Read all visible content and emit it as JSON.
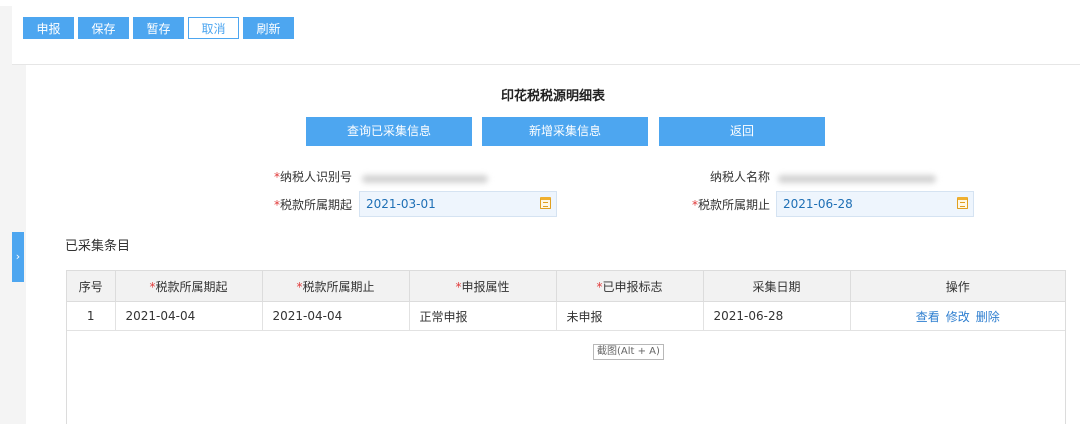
{
  "toolbar": {
    "declare_label": "申报",
    "save_label": "保存",
    "temp_save_label": "暂存",
    "cancel_label": "取消",
    "refresh_label": "刷新"
  },
  "page": {
    "title": "印花税税源明细表"
  },
  "actions": {
    "query_collected_label": "查询已采集信息",
    "add_collect_label": "新增采集信息",
    "back_label": "返回"
  },
  "form": {
    "taxpayer_id_label": "纳税人识别号",
    "taxpayer_name_label": "纳税人名称",
    "period_start_label": "税款所属期起",
    "period_start_value": "2021-03-01",
    "period_end_label": "税款所属期止",
    "period_end_value": "2021-06-28",
    "required_mark": "*"
  },
  "section": {
    "collected_title": "已采集条目"
  },
  "table": {
    "headers": {
      "index": "序号",
      "period_start": "税款所属期起",
      "period_end": "税款所属期止",
      "declare_attr": "申报属性",
      "declared_flag": "已申报标志",
      "collect_date": "采集日期",
      "operation": "操作"
    },
    "rows": [
      {
        "index": "1",
        "period_start": "2021-04-04",
        "period_end": "2021-04-04",
        "declare_attr": "正常申报",
        "declared_flag": "未申报",
        "collect_date": "2021-06-28",
        "ops": {
          "view": "查看",
          "edit": "修改",
          "delete": "删除"
        }
      }
    ]
  },
  "tooltip": {
    "text": "截图(Alt + A)"
  },
  "icons": {
    "calendar": "calendar-icon",
    "expand": "chevron-right-icon"
  },
  "colors": {
    "primary": "#4da6f0",
    "required": "#e03a3a",
    "link": "#2f7fd0",
    "date_text": "#1e6fb5"
  }
}
